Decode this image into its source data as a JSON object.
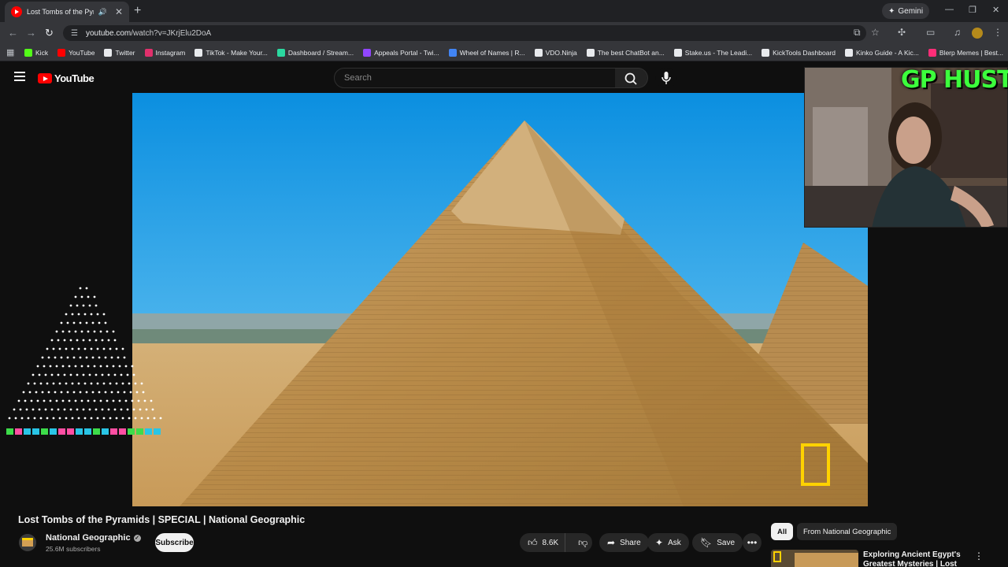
{
  "browser": {
    "tab_title": "Lost Tombs of the Pyramids",
    "gemini_label": "Gemini",
    "url_host": "youtube.com",
    "url_path": "/watch?v=JKrjElu2DoA",
    "bookmarks": [
      {
        "label": "Kick",
        "color": "#53fc18"
      },
      {
        "label": "YouTube",
        "color": "#ff0000"
      },
      {
        "label": "Twitter",
        "color": "#e8eaed"
      },
      {
        "label": "Instagram",
        "color": "#e1306c"
      },
      {
        "label": "TikTok - Make Your...",
        "color": "#e8eaed"
      },
      {
        "label": "Dashboard / Stream...",
        "color": "#2bd9a0"
      },
      {
        "label": "Appeals Portal - Twi...",
        "color": "#9146ff"
      },
      {
        "label": "Wheel of Names | R...",
        "color": "#4285f4"
      },
      {
        "label": "VDO.Ninja",
        "color": "#e8eaed"
      },
      {
        "label": "The best ChatBot an...",
        "color": "#e8eaed"
      },
      {
        "label": "Stake.us - The Leadi...",
        "color": "#e8eaed"
      },
      {
        "label": "KickTools Dashboard",
        "color": "#e8eaed"
      },
      {
        "label": "Kinko Guide - A Kic...",
        "color": "#e8eaed"
      },
      {
        "label": "Blerp Memes | Best...",
        "color": "#ff2d78"
      }
    ]
  },
  "youtube": {
    "logo_text": "YouTube",
    "search_placeholder": "Search"
  },
  "overlay": {
    "webcam_title": "GP HUSTLA"
  },
  "video": {
    "title": "Lost Tombs of the Pyramids | SPECIAL | National Geographic",
    "channel": "National Geographic",
    "subscribers": "25.6M subscribers",
    "subscribe_label": "Subscribe",
    "likes": "8.6K",
    "share_label": "Share",
    "ask_label": "Ask",
    "save_label": "Save"
  },
  "sidebar": {
    "chips": [
      "All",
      "From National Geographic"
    ],
    "recommended_title": "Exploring Ancient Egypt's Greatest Mysteries | Lost"
  },
  "colors": {
    "accent": "#ff0000",
    "overlay_green": "#3cff3c",
    "natgeo_yellow": "#ffd200"
  }
}
